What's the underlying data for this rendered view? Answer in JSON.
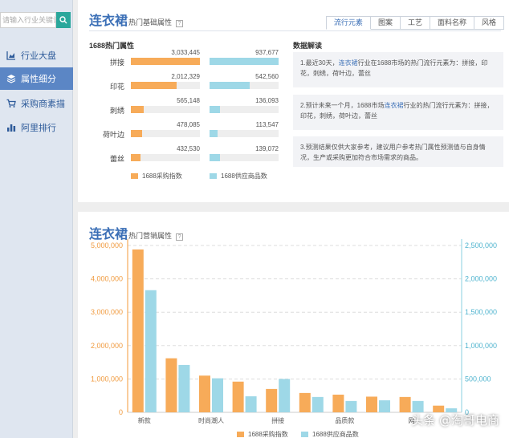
{
  "sidebar": {
    "search_placeholder": "请输入行业关键词",
    "items": [
      {
        "label": "行业大盘",
        "icon": "area-chart-icon"
      },
      {
        "label": "属性细分",
        "icon": "layers-icon",
        "active": true
      },
      {
        "label": "采购商素描",
        "icon": "cart-icon"
      },
      {
        "label": "阿里排行",
        "icon": "bar-chart-icon"
      }
    ]
  },
  "top_panel": {
    "title_main": "连衣裙",
    "title_sub": "热门基础属性",
    "help": "?",
    "tabs": [
      "流行元素",
      "图案",
      "工艺",
      "面料名称",
      "风格"
    ],
    "active_tab": 0,
    "left_section_title": "1688热门属性",
    "attributes": [
      {
        "label": "拼接",
        "purchase": "3,033,445",
        "purchase_frac": 1.0,
        "supply": "937,677",
        "supply_frac": 1.0
      },
      {
        "label": "印花",
        "purchase": "2,012,329",
        "purchase_frac": 0.66,
        "supply": "542,560",
        "supply_frac": 0.58
      },
      {
        "label": "刺绣",
        "purchase": "565,148",
        "purchase_frac": 0.19,
        "supply": "136,093",
        "supply_frac": 0.15
      },
      {
        "label": "荷叶边",
        "purchase": "478,085",
        "purchase_frac": 0.16,
        "supply": "113,547",
        "supply_frac": 0.12
      },
      {
        "label": "蕾丝",
        "purchase": "432,530",
        "purchase_frac": 0.14,
        "supply": "139,072",
        "supply_frac": 0.15
      }
    ],
    "legend": {
      "purchase": "1688采购指数",
      "supply": "1688供应商品数"
    },
    "right_section_title": "数据解读",
    "analysis": [
      {
        "prefix": "1.最近30天，",
        "highlight": "连衣裙",
        "suffix": "行业在1688市场的热门流行元素为：拼接，印花，刺绣，荷叶边，蕾丝"
      },
      {
        "prefix": "2.预计未来一个月，1688市场",
        "highlight": "连衣裙",
        "suffix": "行业的热门流行元素为：拼接，印花，刺绣，荷叶边，蕾丝"
      },
      {
        "prefix": "3.预测结果仅供大家参考，建议用户参考热门属性预测值与自身情况，生产或采购更加符合市场需求的商品。",
        "highlight": "",
        "suffix": ""
      }
    ]
  },
  "bottom_panel": {
    "title_main": "连衣裙",
    "title_sub": "热门营销属性",
    "help": "?",
    "legend": {
      "purchase": "1688采购指数",
      "supply": "1688供应商品数"
    }
  },
  "colors": {
    "purchase": "#f7ab59",
    "supply": "#9ed8e7",
    "accent": "#3b6fb6"
  },
  "chart_data": {
    "type": "bar",
    "categories": [
      "新款",
      "",
      "时尚潮人",
      "",
      "拼接",
      "",
      "品质款",
      "",
      "网",
      ""
    ],
    "series": [
      {
        "name": "1688采购指数",
        "axis": "left",
        "values": [
          4880000,
          1620000,
          1100000,
          920000,
          700000,
          580000,
          530000,
          470000,
          460000,
          200000
        ]
      },
      {
        "name": "1688供应商品数",
        "axis": "right",
        "values": [
          1830000,
          710000,
          510000,
          240000,
          500000,
          230000,
          170000,
          180000,
          170000,
          60000
        ]
      }
    ],
    "left_ticks": [
      "5,000,000",
      "4,000,000",
      "3,000,000",
      "2,000,000",
      "1,000,000",
      "0"
    ],
    "right_ticks": [
      "2,500,000",
      "2,000,000",
      "1,500,000",
      "1,000,000",
      "500,000",
      "0"
    ],
    "ylim_left": [
      0,
      5000000
    ],
    "ylim_right": [
      0,
      2500000
    ],
    "grid": true,
    "legend_position": "bottom-center"
  },
  "watermark": "头条 @淘哥电商"
}
